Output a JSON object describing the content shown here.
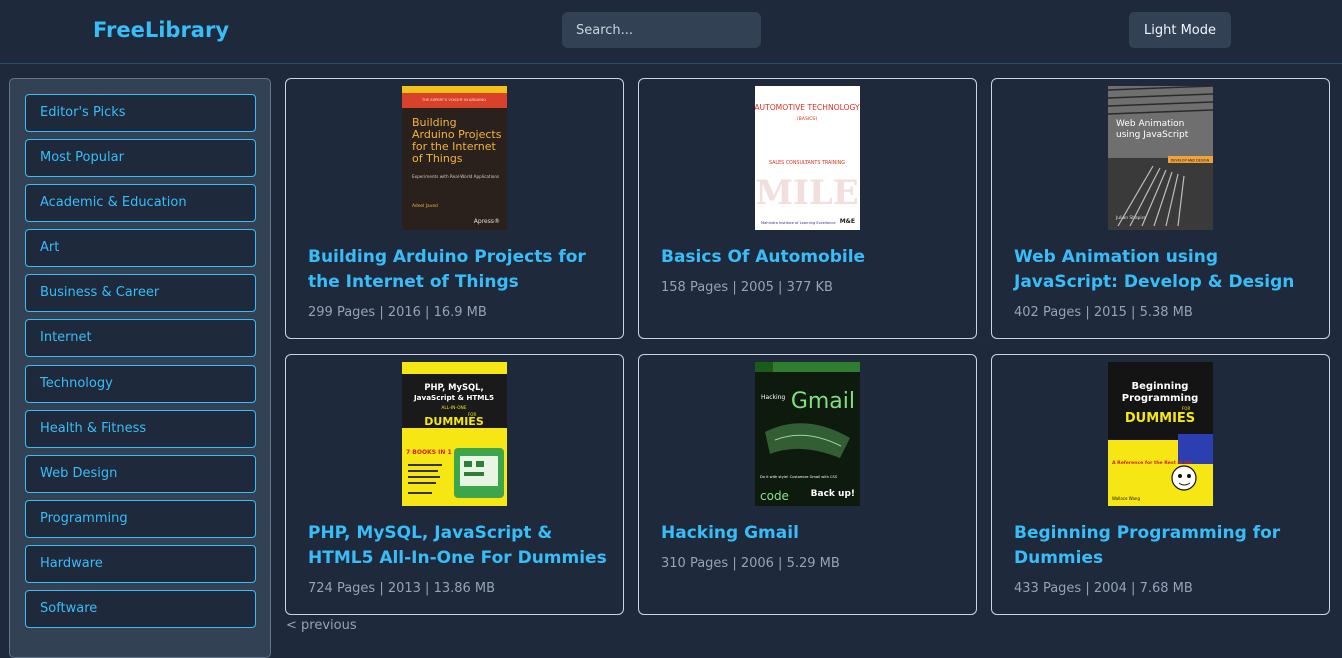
{
  "header": {
    "logo": "FreeLibrary",
    "search_placeholder": "Search...",
    "mode_button": "Light Mode"
  },
  "sidebar": {
    "categories": [
      "Editor's Picks",
      "Most Popular",
      "Academic & Education",
      "Art",
      "Business & Career",
      "Internet",
      "Technology",
      "Health & Fitness",
      "Web Design",
      "Programming",
      "Hardware",
      "Software"
    ]
  },
  "books": [
    {
      "title": "Building Arduino Projects for the Internet of Things",
      "meta": "299 Pages | 2016 | 16.9 MB",
      "cover": {
        "banner": "THE EXPERT'S VOICE® IN ARDUINO",
        "title_lines": [
          "Building",
          "Arduino Projects",
          "for the Internet",
          "of Things"
        ],
        "subtitle": "Experiments with Real-World Applications",
        "author": "Adeel Javed",
        "publisher": "Apress®"
      }
    },
    {
      "title": "Basics Of Automobile",
      "meta": "158 Pages | 2005 | 377 KB",
      "cover": {
        "title": "AUTOMOTIVE TECHNOLOGY",
        "subtitle": "(BASICS)",
        "mid": "SALES CONSULTANTS TRAINING",
        "watermark": "MILE",
        "footer": "Mahindra Institute of Learning Excellence",
        "badge": "M&E"
      }
    },
    {
      "title": "Web Animation using JavaScript: Develop & Design",
      "meta": "402 Pages | 2015 | 5.38 MB",
      "cover": {
        "title_lines": [
          "Web Animation",
          "using JavaScript"
        ],
        "series": "DEVELOP AND DESIGN",
        "author": "Julian Shapiro"
      }
    },
    {
      "title": "PHP, MySQL, JavaScript & HTML5 All-In-One For Dummies",
      "meta": "724 Pages | 2013 | 13.86 MB",
      "cover": {
        "title_lines": [
          "PHP, MySQL,",
          "JavaScript & HTML5"
        ],
        "aio": "ALL-IN-ONE",
        "for": "FOR",
        "brand": "DUMMIES",
        "books_badge": "7 BOOKS IN 1"
      }
    },
    {
      "title": "Hacking Gmail",
      "meta": "310 Pages | 2006 | 5.29 MB",
      "cover": {
        "label": "Hacking",
        "big": "Gmail",
        "tag1": "Do it with style! Customize Gmail with CSS",
        "code": "code",
        "backup": "Back up!"
      }
    },
    {
      "title": "Beginning Programming for Dummies",
      "meta": "433 Pages | 2004 | 7.68 MB",
      "cover": {
        "title_lines": [
          "Beginning",
          "Programming"
        ],
        "for": "FOR",
        "brand": "DUMMIES",
        "tag": "A Reference for the Rest of Us!",
        "author": "Wallace Wang"
      }
    }
  ],
  "pager": {
    "previous": "< previous"
  },
  "colors": {
    "background": "#1e293b",
    "panel": "#334155",
    "accent": "#38bdf8",
    "muted": "#94a3b8"
  }
}
